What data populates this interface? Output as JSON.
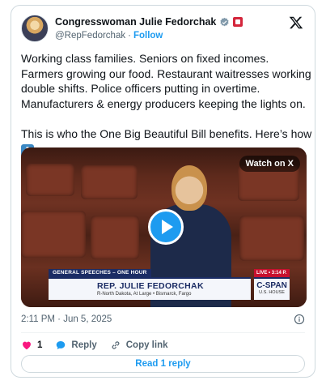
{
  "author": {
    "display_name": "Congresswoman Julie Fedorchak",
    "handle": "@RepFedorchak",
    "separator": "·",
    "follow_label": "Follow"
  },
  "tweet": {
    "text": "Working class families. Seniors on fixed incomes. Farmers growing our food. Restaurant waitresses working double shifts. Police officers putting in overtime. Manufacturers & energy producers keeping the lights on.\n\nThis is who the One Big Beautiful Bill benefits. Here’s how ",
    "emoji": "⬇"
  },
  "video": {
    "watch_label": "Watch on X",
    "lower_third": {
      "tag": "GENERAL SPEECHES – ONE HOUR",
      "name": "REP. JULIE FEDORCHAK",
      "subtitle": "R-North Dakota, At Large  •  Bismarck, Fargo",
      "live": "LIVE  •  3:14 P.",
      "network": "C-SPAN",
      "network_sub": "U.S. HOUSE"
    }
  },
  "meta": {
    "timestamp": "2:11 PM · Jun 5, 2025"
  },
  "actions": {
    "like_count": "1",
    "reply_label": "Reply",
    "copy_link_label": "Copy link"
  },
  "read_replies_label": "Read 1 reply",
  "colors": {
    "accent": "#1d9bf0",
    "like": "#f91880",
    "text": "#0f1419",
    "muted": "#536471"
  }
}
